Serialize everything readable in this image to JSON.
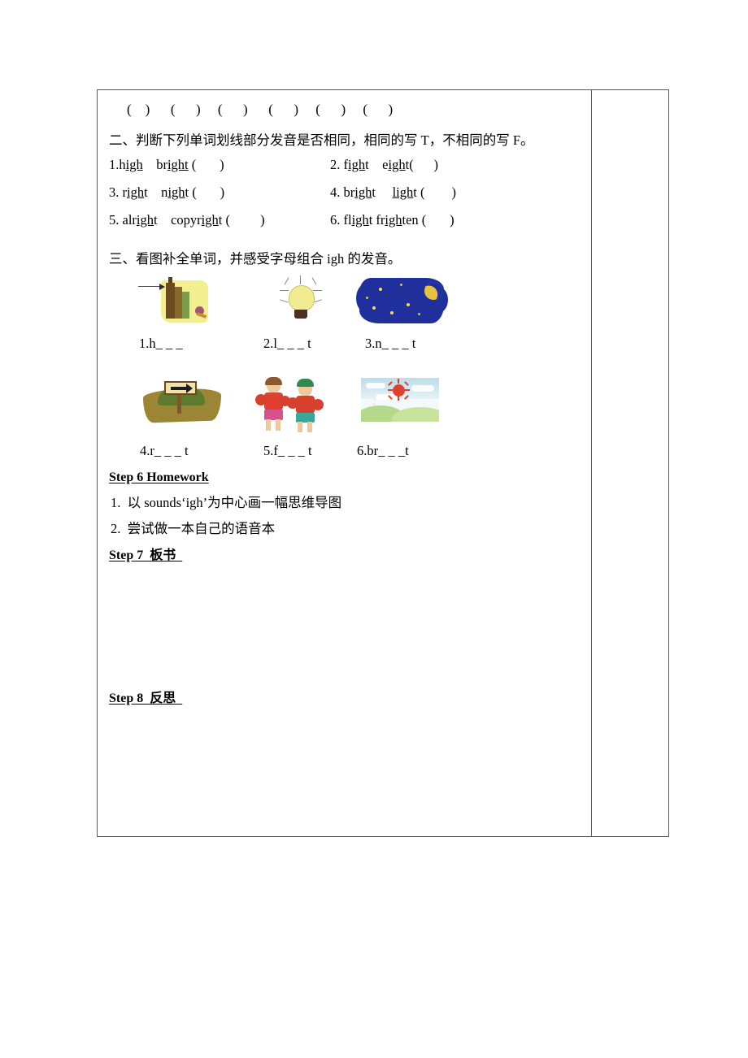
{
  "worksheet": {
    "paren_row": "(    )      (      )     (      )      (      )     (      )     (      )",
    "section_two": {
      "heading": "二、判断下列单词划线部分发音是否相同，相同的写 T，不相同的写 F。",
      "items": [
        {
          "num": "1.",
          "word1": "high",
          "word2": "bright",
          "bracket": "(        )",
          "u1": "igh",
          "u2": "ight"
        },
        {
          "num": "2. ",
          "word1": "fight",
          "word2": "eight",
          "bracket": "(       )",
          "u1": "igh",
          "u2": "igh"
        },
        {
          "num": "3. ",
          "word1": "right",
          "word2": "night",
          "bracket": "(        )",
          "u1": "igh",
          "u2": "igh"
        },
        {
          "num": "4. ",
          "word1": "bright",
          "word2": "light",
          "bracket": "(        )",
          "u1": "igh",
          "u2": "ight"
        },
        {
          "num": "5. ",
          "word1": "alright",
          "word2": "copyright",
          "bracket": "(         )",
          "u1": "ight",
          "u2": "ight"
        },
        {
          "num": "6. ",
          "word1": "flight",
          "word2": "frighten",
          "bracket": "(       )",
          "u1": "igh",
          "u2": "igh"
        }
      ],
      "rows_text": [
        "1.high    bright (        )                  2. fight    eight(       )",
        "3. right    night (        )               4. bright     light (        )",
        "5. alright    copyright (         )  6. flight frighten (       )"
      ]
    },
    "section_three": {
      "heading": "三、看图补全单词，并感受字母组合 igh 的发音。",
      "pictures": [
        {
          "id": "high-building-picture",
          "label": "1.h_ _ _",
          "alt": "tall-building-icon"
        },
        {
          "id": "light-bulb-picture",
          "label": "2.l_ _ _ t",
          "alt": "light-bulb-icon"
        },
        {
          "id": "night-sky-picture",
          "label": "3.n_ _ _ t",
          "alt": "night-sky-moon-icon"
        },
        {
          "id": "right-road-sign-picture",
          "label": "4.r_ _ _ t",
          "alt": "road-arrow-sign-icon"
        },
        {
          "id": "fight-boxers-picture",
          "label": "5.f_ _ _ t",
          "alt": "two-boxers-icon"
        },
        {
          "id": "bright-sun-picture",
          "label": "6.br_ _ _t",
          "alt": "bright-sun-hills-icon"
        }
      ]
    },
    "step6": {
      "heading": "Step 6 Homework",
      "items": [
        "1.  以 sounds‘igh’为中心画一幅思维导图",
        "2.  尝试做一本自己的语音本"
      ]
    },
    "step7": {
      "heading": "Step 7  板书"
    },
    "step8": {
      "heading": "Step 8  反思"
    }
  },
  "colors": {
    "border": "#5a5a5a",
    "text": "#000000",
    "page_bg": "#ffffff",
    "night_sky": "#1f2f9c",
    "moon": "#e8c23c",
    "bulb": "#f1ec8f",
    "sun": "#e0402f"
  }
}
